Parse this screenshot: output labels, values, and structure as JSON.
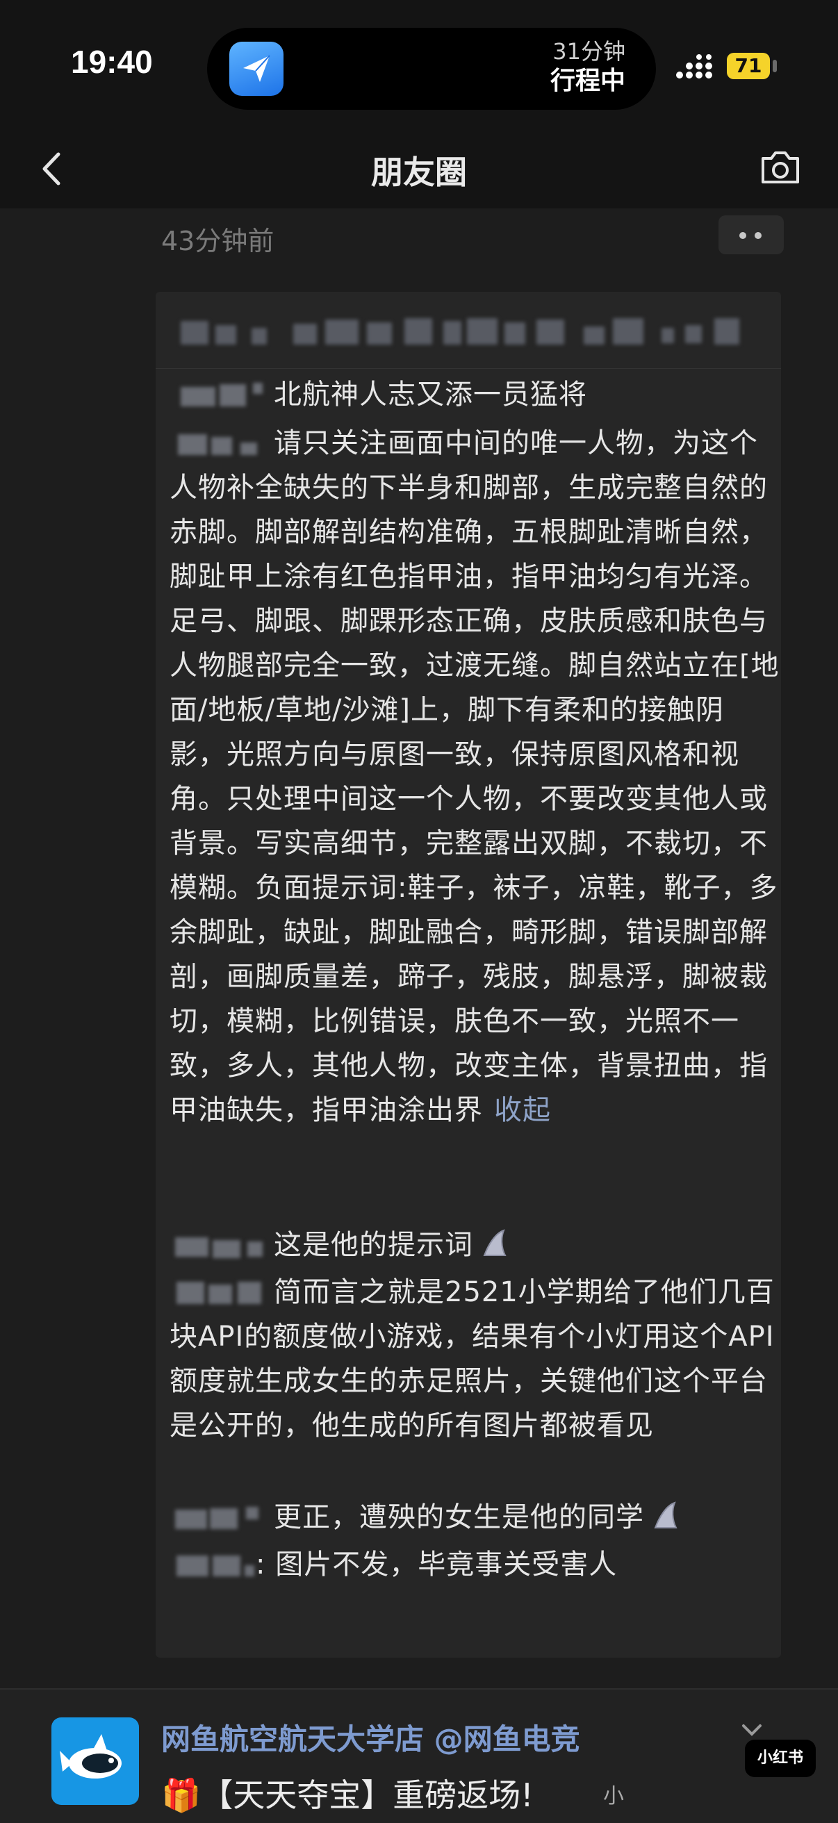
{
  "status_bar": {
    "time": "19:40",
    "live_activity": {
      "line1": "31分钟",
      "line2": "行程中"
    },
    "battery": "71"
  },
  "nav": {
    "title": "朋友圈"
  },
  "post": {
    "time": "43分钟前"
  },
  "comments": [
    {
      "text": "北航神人志又添一员猛将"
    },
    {
      "text": "请只关注画面中间的唯一人物，为这个人物补全缺失的下半身和脚部，生成完整自然的赤脚。脚部解剖结构准确，五根脚趾清晰自然，脚趾甲上涂有红色指甲油，指甲油均匀有光泽。足弓、脚跟、脚踝形态正确，皮肤质感和肤色与人物腿部完全一致，过渡无缝。脚自然站立在[地面/地板/草地/沙滩]上，脚下有柔和的接触阴影，光照方向与原图一致，保持原图风格和视角。只处理中间这一个人物，不要改变其他人或背景。写实高细节，完整露出双脚，不裁切，不模糊。负面提示词:鞋子，袜子，凉鞋，靴子，多余脚趾，缺趾，脚趾融合，畸形脚，错误脚部解剖，画脚质量差，蹄子，残肢，脚悬浮，脚被裁切，模糊，比例错误，肤色不一致，光照不一致，多人，其他人物，改变主体，背景扭曲，指甲油缺失，指甲油涂出界",
      "collapse": "收起"
    },
    {
      "text": "这是他的提示词"
    },
    {
      "text": "简而言之就是2521小学期给了他们几百块API的额度做小游戏，结果有个小灯用这个API额度就生成女生的赤足照片，关键他们这个平台是公开的，他生成的所有图片都被看见"
    },
    {
      "text": "更正，遭殃的女生是他的同学"
    },
    {
      "text": ": 图片不发，毕竟事关受害人"
    }
  ],
  "bottom": {
    "shop_name": "网鱼航空航天大学店",
    "shop_handle": "@网鱼电竞",
    "promo": "🎁【天天夺宝】重磅返场!",
    "promo_small": "小",
    "watermark": "小红书"
  },
  "colors": {
    "background": "#1b1b1b",
    "panel": "#262626",
    "link": "#8ea3c8",
    "battery": "#f5d32a"
  }
}
